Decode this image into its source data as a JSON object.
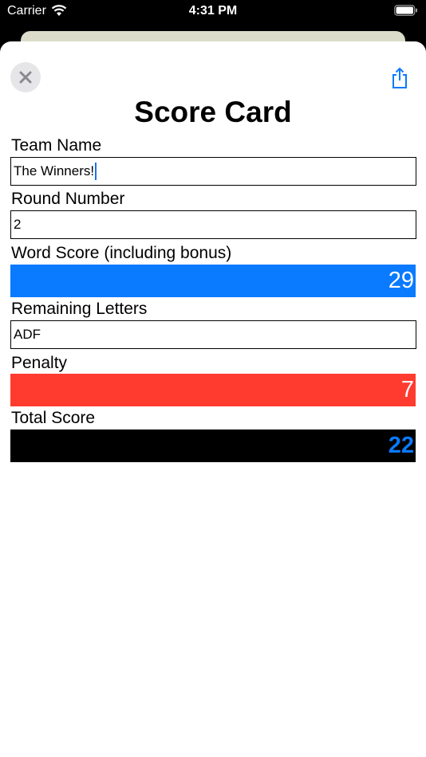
{
  "status_bar": {
    "carrier": "Carrier",
    "time": "4:31 PM"
  },
  "sheet": {
    "title": "Score Card",
    "close_icon": "close-icon",
    "share_icon": "share-icon"
  },
  "fields": {
    "team_name": {
      "label": "Team Name",
      "value": "The Winners!"
    },
    "round_number": {
      "label": "Round Number",
      "value": "2"
    },
    "word_score": {
      "label": "Word Score (including bonus)",
      "value": "29",
      "color": "#0a7aff"
    },
    "remaining_letters": {
      "label": "Remaining Letters",
      "value": "ADF"
    },
    "penalty": {
      "label": "Penalty",
      "value": "7",
      "color": "#ff3b30"
    },
    "total_score": {
      "label": "Total Score",
      "value": "22",
      "color": "#000000",
      "text_color": "#0a7aff"
    }
  }
}
